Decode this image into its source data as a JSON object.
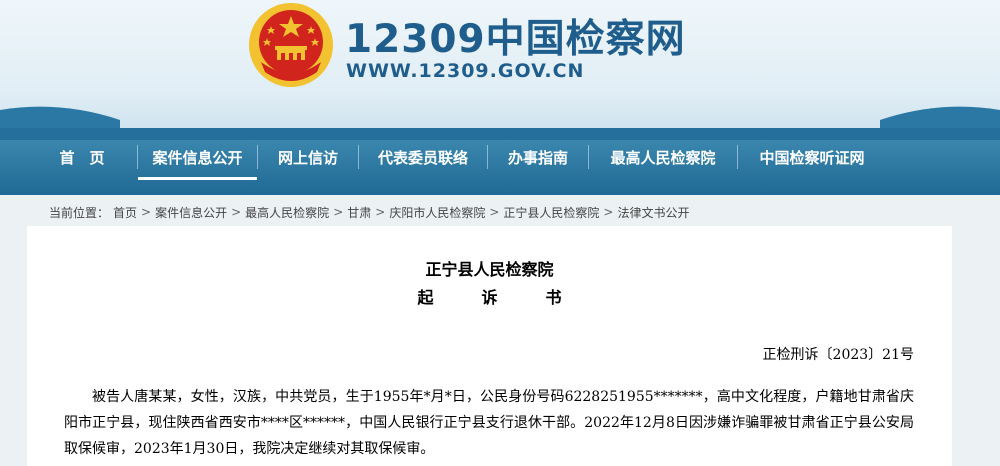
{
  "brand": {
    "title": "12309中国检察网",
    "url": "WWW.12309.GOV.CN",
    "emblem_colors": {
      "red": "#d0241c",
      "gold": "#f2c230"
    }
  },
  "nav": {
    "items": [
      {
        "label": "首　页",
        "active": false
      },
      {
        "label": "案件信息公开",
        "active": true
      },
      {
        "label": "网上信访",
        "active": false
      },
      {
        "label": "代表委员联络",
        "active": false
      },
      {
        "label": "办事指南",
        "active": false
      },
      {
        "label": "最高人民检察院",
        "active": false
      },
      {
        "label": "中国检察听证网",
        "active": false
      }
    ]
  },
  "breadcrumb": {
    "prefix": "当前位置：",
    "items": [
      "首页",
      "案件信息公开",
      "最高人民检察院",
      "甘肃",
      "庆阳市人民检察院",
      "正宁县人民检察院",
      "法律文书公开"
    ],
    "separator": ">"
  },
  "document": {
    "organization": "正宁县人民检察院",
    "type": "起诉书",
    "number": "正检刑诉〔2023〕21号",
    "body": "被告人唐某某，女性，汉族，中共党员，生于1955年*月*日，公民身份号码6228251955*******，高中文化程度，户籍地甘肃省庆阳市正宁县，现住陕西省西安市****区******，中国人民银行正宁县支行退休干部。2022年12月8日因涉嫌诈骗罪被甘肃省正宁县公安局取保候审，2023年1月30日，我院决定继续对其取保候审。"
  },
  "colors": {
    "brand_blue": "#1f5d8c",
    "nav_bg": "#1f6a96",
    "page_bg": "#ecf1f4"
  }
}
